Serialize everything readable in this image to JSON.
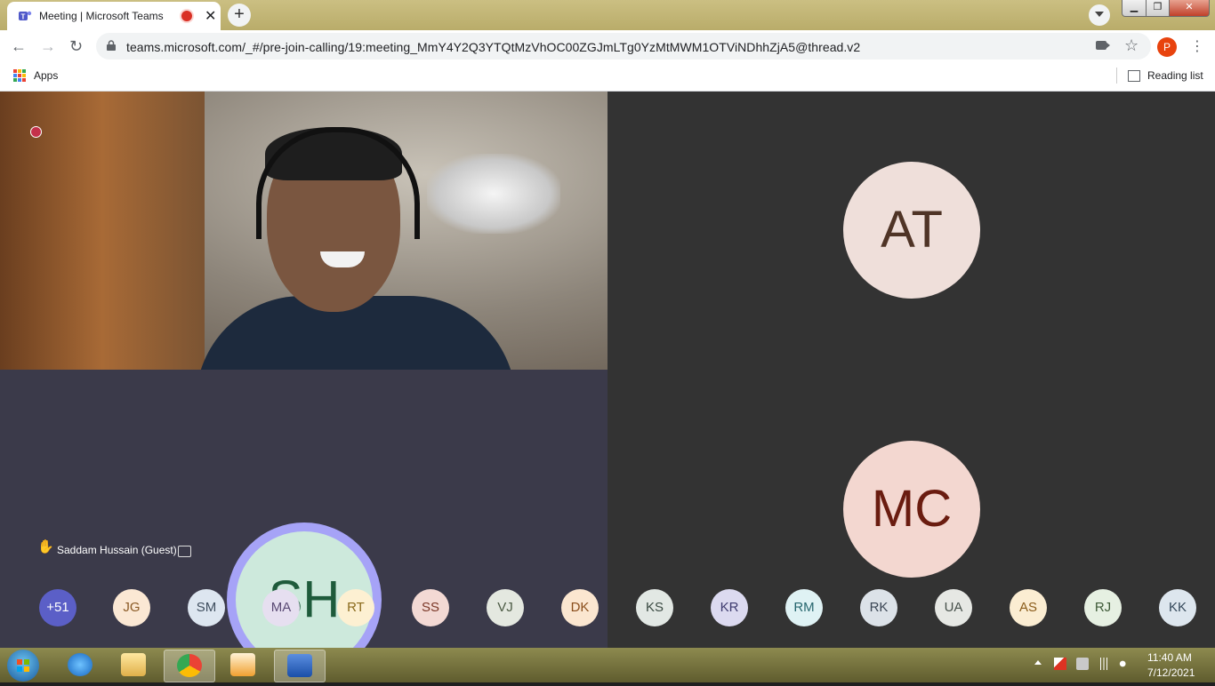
{
  "browser": {
    "tab_title": "Meeting | Microsoft Teams",
    "tab_close": "✕",
    "new_tab": "+",
    "url": "teams.microsoft.com/_#/pre-join-calling/19:meeting_MmY4Y2Q3YTQtMzVhOC00ZGJmLTg0YzMtMWM1OTViNDhhZjA5@thread.v2",
    "back": "←",
    "forward": "→",
    "reload": "↻",
    "star": "☆",
    "profile_initial": "P",
    "menu": "⋮",
    "window_min": "▁",
    "window_max": "❐",
    "window_close": "✕",
    "bookmarks": {
      "apps_label": "Apps",
      "reading_list_label": "Reading list"
    }
  },
  "meeting": {
    "tiles": {
      "at": {
        "initials": "AT"
      },
      "sh": {
        "initials": "SH",
        "name": "Saddam Hussain (Guest)",
        "hand": "✋"
      },
      "mc": {
        "initials": "MC"
      }
    },
    "overflow": {
      "label": "+51",
      "bg": "#5b5fc7",
      "fg": "#ffffff"
    },
    "participants": [
      {
        "initials": "JG",
        "bg": "#fbe8d4",
        "fg": "#8a5a26"
      },
      {
        "initials": "SM",
        "bg": "#dde6f0",
        "fg": "#3f4e5e"
      },
      {
        "initials": "MA",
        "bg": "#e6dff0",
        "fg": "#5a4a74"
      },
      {
        "initials": "RT",
        "bg": "#fdf0d2",
        "fg": "#8a6a1c"
      },
      {
        "initials": "SS",
        "bg": "#f3d9d4",
        "fg": "#7a3626"
      },
      {
        "initials": "VJ",
        "bg": "#e4e8e0",
        "fg": "#4b5a44"
      },
      {
        "initials": "DK",
        "bg": "#fbe6d0",
        "fg": "#8a4e1c"
      },
      {
        "initials": "KS",
        "bg": "#e2e8e4",
        "fg": "#3a4a42"
      },
      {
        "initials": "KR",
        "bg": "#dcdaf0",
        "fg": "#3d3a6e"
      },
      {
        "initials": "RM",
        "bg": "#dff2f4",
        "fg": "#26666e"
      },
      {
        "initials": "RK",
        "bg": "#dce2e8",
        "fg": "#3a4654"
      },
      {
        "initials": "UA",
        "bg": "#e6e8e4",
        "fg": "#46504a"
      },
      {
        "initials": "AS",
        "bg": "#fbedd2",
        "fg": "#8a5c1a"
      },
      {
        "initials": "RJ",
        "bg": "#e6f0e2",
        "fg": "#3e5a38"
      },
      {
        "initials": "KK",
        "bg": "#dde6ee",
        "fg": "#34485a"
      }
    ]
  },
  "taskbar": {
    "time": "11:40 AM",
    "date": "7/12/2021"
  }
}
